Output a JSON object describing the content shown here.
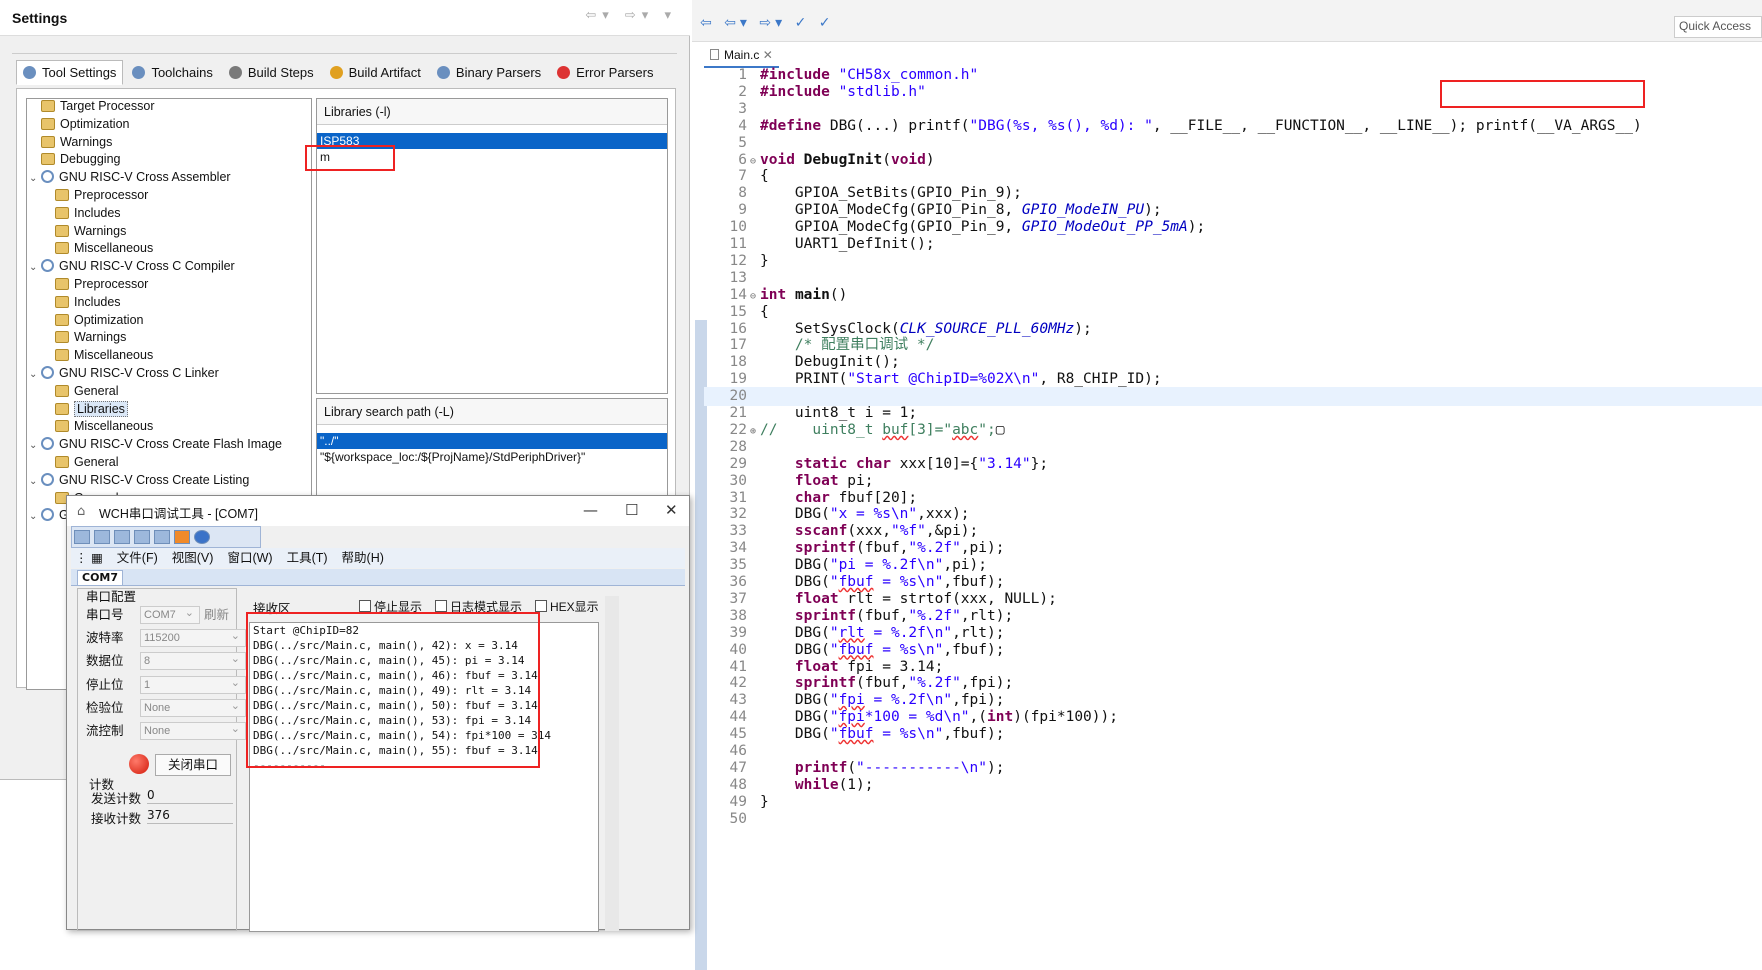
{
  "settings": {
    "title": "Settings",
    "tabs": [
      "Tool Settings",
      "Toolchains",
      "Build Steps",
      "Build Artifact",
      "Binary Parsers",
      "Error Parsers"
    ],
    "tree": [
      {
        "label": "Target Processor",
        "level": 1,
        "kind": "leaf"
      },
      {
        "label": "Optimization",
        "level": 1,
        "kind": "leaf"
      },
      {
        "label": "Warnings",
        "level": 1,
        "kind": "leaf"
      },
      {
        "label": "Debugging",
        "level": 1,
        "kind": "leaf"
      },
      {
        "label": "GNU RISC-V Cross Assembler",
        "level": 0,
        "kind": "group"
      },
      {
        "label": "Preprocessor",
        "level": 2,
        "kind": "leaf"
      },
      {
        "label": "Includes",
        "level": 2,
        "kind": "leaf"
      },
      {
        "label": "Warnings",
        "level": 2,
        "kind": "leaf"
      },
      {
        "label": "Miscellaneous",
        "level": 2,
        "kind": "leaf"
      },
      {
        "label": "GNU RISC-V Cross C Compiler",
        "level": 0,
        "kind": "group"
      },
      {
        "label": "Preprocessor",
        "level": 2,
        "kind": "leaf"
      },
      {
        "label": "Includes",
        "level": 2,
        "kind": "leaf"
      },
      {
        "label": "Optimization",
        "level": 2,
        "kind": "leaf"
      },
      {
        "label": "Warnings",
        "level": 2,
        "kind": "leaf"
      },
      {
        "label": "Miscellaneous",
        "level": 2,
        "kind": "leaf"
      },
      {
        "label": "GNU RISC-V Cross C Linker",
        "level": 0,
        "kind": "group"
      },
      {
        "label": "General",
        "level": 2,
        "kind": "leaf"
      },
      {
        "label": "Libraries",
        "level": 2,
        "kind": "leaf",
        "selected": true
      },
      {
        "label": "Miscellaneous",
        "level": 2,
        "kind": "leaf"
      },
      {
        "label": "GNU RISC-V Cross Create Flash Image",
        "level": 0,
        "kind": "group"
      },
      {
        "label": "General",
        "level": 2,
        "kind": "leaf"
      },
      {
        "label": "GNU RISC-V Cross Create Listing",
        "level": 0,
        "kind": "group"
      },
      {
        "label": "General",
        "level": 2,
        "kind": "leaf"
      },
      {
        "label": "Gl",
        "level": 0,
        "kind": "group"
      }
    ],
    "libraries": {
      "header": "Libraries (-l)",
      "items": [
        "ISP583",
        "m"
      ]
    },
    "search_path": {
      "header": "Library search path (-L)",
      "items": [
        "\"../\"",
        "\"${workspace_loc:/${ProjName}/StdPeriphDriver}\""
      ]
    }
  },
  "editor": {
    "tab": "Main.c",
    "quick_access": "Quick Access",
    "lines": [
      {
        "n": "1",
        "h": "<span class=\"kw\">#include</span> <span class=\"str\">\"CH58x_common.h\"</span>"
      },
      {
        "n": "2",
        "h": "<span class=\"kw\">#include</span> <span class=\"str\">\"stdlib.h\"</span>"
      },
      {
        "n": "3",
        "h": ""
      },
      {
        "n": "4",
        "h": "<span class=\"kw\">#define</span> DBG(...) printf(<span class=\"str\">\"DBG(%s, %s(), %d): \"</span>, __FILE__, __FUNCTION__, __LINE__); printf(__VA_ARGS__)"
      },
      {
        "n": "5",
        "h": ""
      },
      {
        "n": "6",
        "f": "⊖",
        "h": "<span class=\"kw\">void</span> <b>DebugInit</b>(<span class=\"kw\">void</span>)"
      },
      {
        "n": "7",
        "h": "{"
      },
      {
        "n": "8",
        "h": "    GPIOA_SetBits(GPIO_Pin_9);"
      },
      {
        "n": "9",
        "h": "    GPIOA_ModeCfg(GPIO_Pin_8, <span class=\"mac\">GPIO_ModeIN_PU</span>);"
      },
      {
        "n": "10",
        "h": "    GPIOA_ModeCfg(GPIO_Pin_9, <span class=\"mac\">GPIO_ModeOut_PP_5mA</span>);"
      },
      {
        "n": "11",
        "h": "    UART1_DefInit();"
      },
      {
        "n": "12",
        "h": "}"
      },
      {
        "n": "13",
        "h": ""
      },
      {
        "n": "14",
        "f": "⊖",
        "h": "<span class=\"kw\">int</span> <b>main</b>()"
      },
      {
        "n": "15",
        "h": "{"
      },
      {
        "n": "16",
        "h": "    SetSysClock(<span class=\"mac\">CLK_SOURCE_PLL_60MHz</span>);"
      },
      {
        "n": "17",
        "h": "    <span class=\"cmt\">/* 配置串口调试 */</span>"
      },
      {
        "n": "18",
        "h": "    DebugInit();"
      },
      {
        "n": "19",
        "h": "    PRINT(<span class=\"str\">\"Start @ChipID=%02X\\n\"</span>, R8_CHIP_ID);"
      },
      {
        "n": "20",
        "h": "",
        "cur": true
      },
      {
        "n": "21",
        "h": "    uint8_t i = 1;"
      },
      {
        "n": "22",
        "f": "⊕",
        "h": "<span class=\"cmt\">//    uint8_t <span class=\"sq\">buf</span>[3]=\"<span class=\"sq\">abc</span>\";</span>▢"
      },
      {
        "n": "28",
        "h": ""
      },
      {
        "n": "29",
        "h": "    <span class=\"kw\">static char</span> xxx[10]={<span class=\"str\">\"3.14\"</span>};"
      },
      {
        "n": "30",
        "h": "    <span class=\"kw\">float</span> pi;"
      },
      {
        "n": "31",
        "h": "    <span class=\"kw\">char</span> fbuf[20];"
      },
      {
        "n": "32",
        "h": "    DBG(<span class=\"str\">\"x = %s\\n\"</span>,xxx);"
      },
      {
        "n": "33",
        "h": "    <span class=\"kw\">sscanf</span>(xxx,<span class=\"str\">\"%f\"</span>,&amp;pi);"
      },
      {
        "n": "34",
        "h": "    <span class=\"kw\">sprintf</span>(fbuf,<span class=\"str\">\"%.2f\"</span>,pi);"
      },
      {
        "n": "35",
        "h": "    DBG(<span class=\"str\">\"pi = %.2f\\n\"</span>,pi);"
      },
      {
        "n": "36",
        "h": "    DBG(<span class=\"str\">\"<span class=\"sq\">fbuf</span> = %s\\n\"</span>,fbuf);"
      },
      {
        "n": "37",
        "h": "    <span class=\"kw\">float</span> rlt = strtof(xxx, NULL);"
      },
      {
        "n": "38",
        "h": "    <span class=\"kw\">sprintf</span>(fbuf,<span class=\"str\">\"%.2f\"</span>,rlt);"
      },
      {
        "n": "39",
        "h": "    DBG(<span class=\"str\">\"<span class=\"sq\">rlt</span> = %.2f\\n\"</span>,rlt);"
      },
      {
        "n": "40",
        "h": "    DBG(<span class=\"str\">\"<span class=\"sq\">fbuf</span> = %s\\n\"</span>,fbuf);"
      },
      {
        "n": "41",
        "h": "    <span class=\"kw\">float</span> fpi = 3.14;"
      },
      {
        "n": "42",
        "h": "    <span class=\"kw\">sprintf</span>(fbuf,<span class=\"str\">\"%.2f\"</span>,fpi);"
      },
      {
        "n": "43",
        "h": "    DBG(<span class=\"str\">\"<span class=\"sq\">fpi</span> = %.2f\\n\"</span>,fpi);"
      },
      {
        "n": "44",
        "h": "    DBG(<span class=\"str\">\"<span class=\"sq\">fpi</span>*100 = %d\\n\"</span>,(<span class=\"kw\">int</span>)(fpi*100));"
      },
      {
        "n": "45",
        "h": "    DBG(<span class=\"str\">\"<span class=\"sq\">fbuf</span> = %s\\n\"</span>,fbuf);"
      },
      {
        "n": "46",
        "h": ""
      },
      {
        "n": "47",
        "h": "    <span class=\"kw\">printf</span>(<span class=\"str\">\"-----------\\n\"</span>);"
      },
      {
        "n": "48",
        "h": "    <span class=\"kw\">while</span>(1);"
      },
      {
        "n": "49",
        "f": "",
        "h": "}"
      },
      {
        "n": "50",
        "h": ""
      }
    ]
  },
  "serial": {
    "title": "WCH串口调试工具 - [COM7]",
    "menu": [
      "文件(F)",
      "视图(V)",
      "窗口(W)",
      "工具(T)",
      "帮助(H)"
    ],
    "tab": "COM7",
    "config_title": "串口配置",
    "config": [
      {
        "label": "串口号",
        "value": "COM7",
        "extra": "刷新"
      },
      {
        "label": "波特率",
        "value": "115200"
      },
      {
        "label": "数据位",
        "value": "8"
      },
      {
        "label": "停止位",
        "value": "1"
      },
      {
        "label": "检验位",
        "value": "None"
      },
      {
        "label": "流控制",
        "value": "None"
      }
    ],
    "close_button": "关闭串口",
    "count_title": "计数",
    "sent_label": "发送计数",
    "sent_value": "0",
    "recv_label": "接收计数",
    "recv_value": "376",
    "recv_area_label": "接收区",
    "options": [
      "停止显示",
      "日志模式显示",
      "HEX显示"
    ],
    "received": [
      "Start @ChipID=82",
      "DBG(../src/Main.c, main(), 42): x = 3.14",
      "DBG(../src/Main.c, main(), 45): pi = 3.14",
      "DBG(../src/Main.c, main(), 46): fbuf = 3.14",
      "DBG(../src/Main.c, main(), 49): rlt = 3.14",
      "DBG(../src/Main.c, main(), 50): fbuf = 3.14",
      "DBG(../src/Main.c, main(), 53): fpi = 3.14",
      "DBG(../src/Main.c, main(), 54): fpi*100 = 314",
      "DBG(../src/Main.c, main(), 55): fbuf = 3.14",
      "-----------"
    ]
  },
  "colors": {
    "highlight_box": "#e22222",
    "selection": "#0a64c8",
    "keyword": "#7f0055",
    "string": "#2a00ff"
  }
}
